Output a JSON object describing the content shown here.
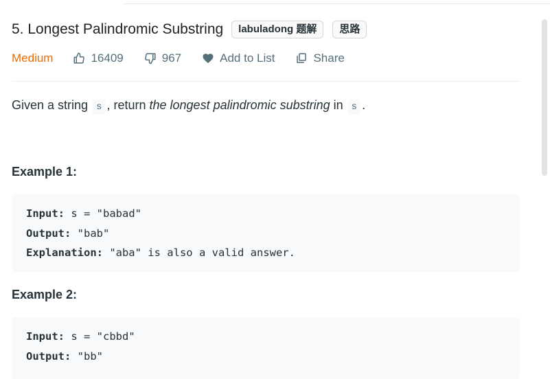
{
  "problem": {
    "title": "5. Longest Palindromic Substring",
    "tags": [
      "labuladong 题解",
      "思路"
    ],
    "difficulty": "Medium",
    "likes": "16409",
    "dislikes": "967",
    "add_to_list": "Add to List",
    "share": "Share"
  },
  "description": {
    "p1": "Given a string ",
    "code1": "s",
    "p2": ", return ",
    "em": "the longest palindromic substring",
    "p3": " in ",
    "code2": "s",
    "p4": "."
  },
  "examples": [
    {
      "title": "Example 1:",
      "input_label": "Input:",
      "input": " s = \"babad\"",
      "output_label": "Output:",
      "output": " \"bab\"",
      "explanation_label": "Explanation:",
      "explanation": " \"aba\" is also a valid answer."
    },
    {
      "title": "Example 2:",
      "input_label": "Input:",
      "input": " s = \"cbbd\"",
      "output_label": "Output:",
      "output": " \"bb\""
    }
  ],
  "colors": {
    "difficulty_medium": "#ef6c00",
    "text": "#263238",
    "muted": "#546e7a",
    "code_bg": "#f7f9fa"
  }
}
